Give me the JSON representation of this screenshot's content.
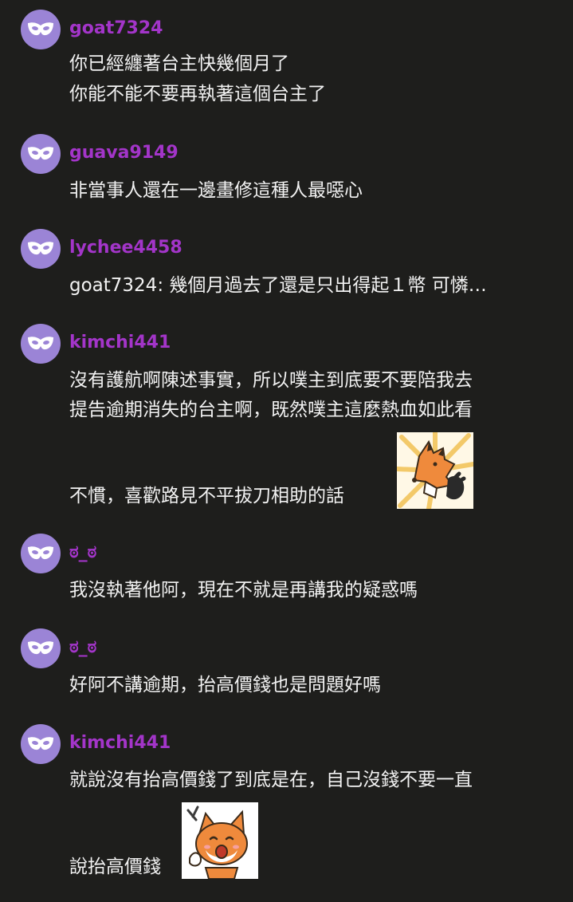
{
  "colors": {
    "background": "#1e1e1c",
    "username": "#a335c9",
    "avatar": "#9b84d6",
    "text": "#f2f2f2"
  },
  "avatar_icon": "masquerade-mask-icon",
  "sticker_icon": "fox-sticker-icon",
  "comments": [
    {
      "username": "goat7324",
      "lines": [
        "你已經纏著台主快幾個月了",
        "你能不能不要再執著這個台主了"
      ]
    },
    {
      "username": "guava9149",
      "lines": [
        "非當事人還在一邊畫修這種人最噁心"
      ]
    },
    {
      "username": "lychee4458",
      "lines": [
        "goat7324: 幾個月過去了還是只出得起１幣 可憐…"
      ]
    },
    {
      "username": "kimchi441",
      "lines": [
        "沒有護航啊陳述事實，所以噗主到底要不要陪我去",
        "提告逾期消失的台主啊，既然噗主這麼熱血如此看",
        "不慣，喜歡路見不平拔刀相助的話"
      ]
    },
    {
      "username": "ಠ_ಠ",
      "lines": [
        "我沒執著他阿，現在不就是再講我的疑惑嗎"
      ]
    },
    {
      "username": "ಠ_ಠ",
      "lines": [
        "好阿不講逾期，抬高價錢也是問題好嗎"
      ]
    },
    {
      "username": "kimchi441",
      "lines": [
        "就說沒有抬高價錢了到底是在，自己沒錢不要一直",
        "說抬高價錢"
      ]
    }
  ]
}
